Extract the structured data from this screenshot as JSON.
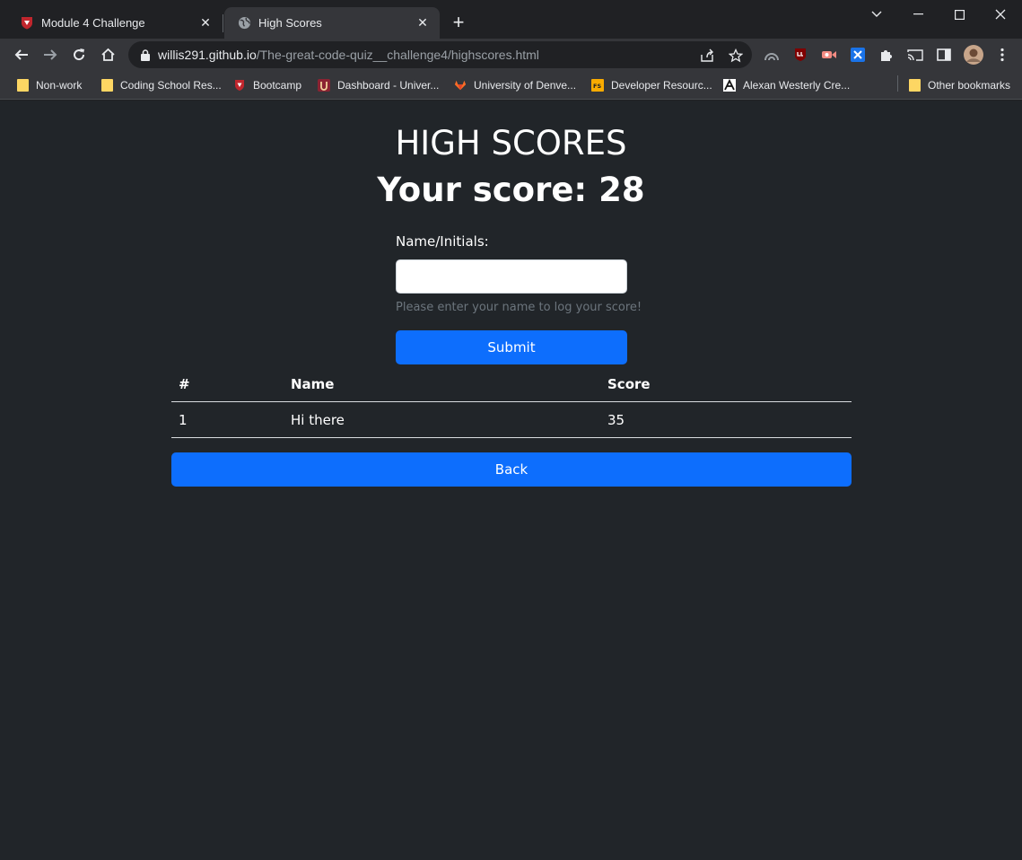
{
  "browser": {
    "tabs": [
      {
        "title": "Module 4 Challenge",
        "active": false
      },
      {
        "title": "High Scores",
        "active": true
      }
    ],
    "url_host": "willis291.github.io",
    "url_path": "/The-great-code-quiz__challenge4/highscores.html",
    "bookmarks": [
      "Non-work",
      "Coding School Res...",
      "Bootcamp",
      "Dashboard - Univer...",
      "University of Denve...",
      "Developer Resourc...",
      "Alexan Westerly Cre...",
      "Other bookmarks"
    ]
  },
  "page": {
    "heading": "HIGH SCORES",
    "score_text": "Your score: 28",
    "name_label": "Name/Initials:",
    "name_value": "",
    "hint": "Please enter your name to log your score!",
    "submit_label": "Submit",
    "table": {
      "headers": [
        "#",
        "Name",
        "Score"
      ],
      "rows": [
        [
          "1",
          "Hi there",
          "35"
        ]
      ]
    },
    "back_label": "Back"
  },
  "colors": {
    "page_bg": "#212529",
    "button": "#0d6efd",
    "chrome_bg": "#202124",
    "toolbar_bg": "#35363a"
  }
}
